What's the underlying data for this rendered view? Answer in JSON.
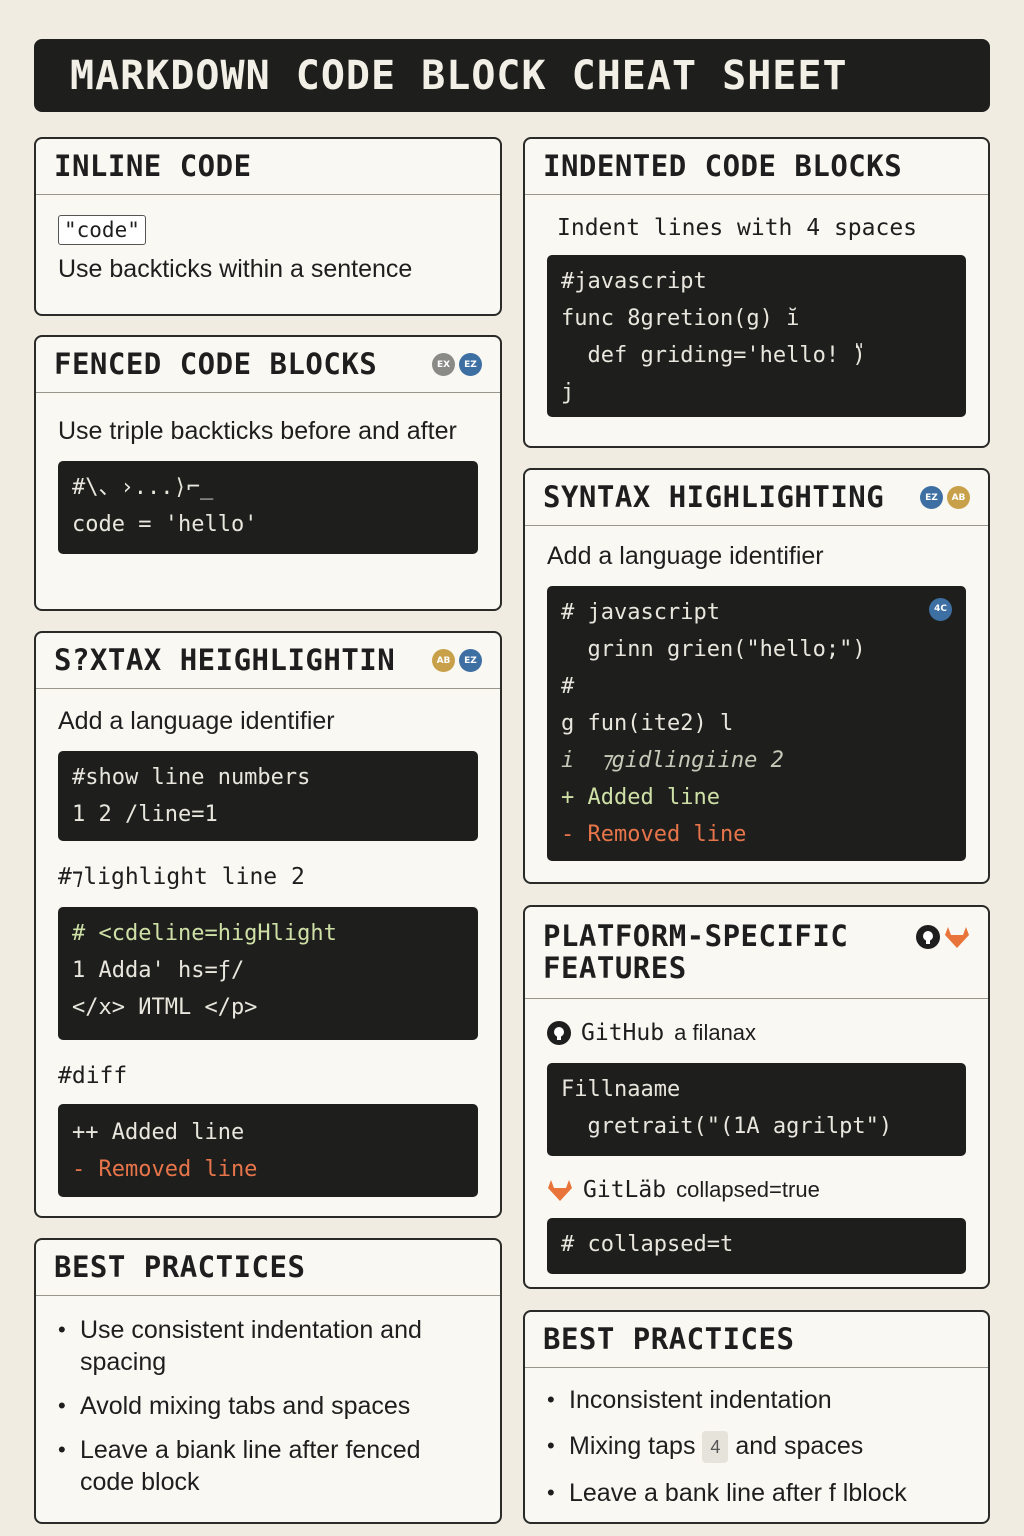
{
  "title": "MARKDOWN CODE BLOCK CHEAT SHEET",
  "inline_code": {
    "heading": "INLINE CODE",
    "chip": "\"code\"",
    "description": "Use backticks within a sentence"
  },
  "fenced": {
    "heading": "FENCED CODE BLOCKS",
    "description": "Use triple backticks before and after",
    "code": [
      "#\\、›...⟩⌐_",
      "code = 'hello'"
    ]
  },
  "syntax_left": {
    "heading": "S?XTAX HEIGHLIGHTIN",
    "description": "Add a language identifier",
    "block1": [
      "#show line numbers",
      "1 2 /line=1"
    ],
    "highlight_label": "#⁊lighlight line 2",
    "block2": [
      "# <cdeline=higHlight",
      "1 Adda' hs=ƒ/",
      "</x> ИTML </p>"
    ],
    "diff_label": "#diff",
    "diff": [
      "++ Added line",
      "- Removed line"
    ]
  },
  "best_left": {
    "heading": "BEST PRACTICES",
    "items": [
      "Use consistent indentation and spacing",
      "Avold mixing tabs and spaces",
      "Leave a biank line after fenced code block"
    ]
  },
  "indented": {
    "heading": "INDENTED CODE BLOCKS",
    "description": "Indent lines with 4 spaces",
    "code": [
      "#javascript",
      "func 8gretion(g) ĭ",
      "  def griding='hello! ̎)",
      "j"
    ]
  },
  "syntax_right": {
    "heading": "SYNTAX HIGHLIGHTING",
    "description": "Add a language identifier",
    "code": [
      "# javascript",
      "  grinn grien(\"hello;\")",
      "#",
      "g fun(ite2) l",
      "i  ⁊gidlingiine 2"
    ],
    "added": "+ Added line",
    "removed": "- Removed line",
    "badge": "4C"
  },
  "platform": {
    "heading": "PLATFORM-SPECIFIC FEATURES",
    "github_label": "GitHub",
    "github_extra": "a filanax",
    "github_code": [
      "Fillnaame",
      "  gretrait(\"(1A agrilpt\")"
    ],
    "gitlab_label": "GitLäb",
    "gitlab_extra": "collapsed=true",
    "gitlab_code": [
      "# collapsed=t"
    ]
  },
  "best_right": {
    "heading": "BEST PRACTICES",
    "item1": "Inconsistent indentation",
    "item2_a": "Mixing taps",
    "item2_chip": "4",
    "item2_b": "and spaces",
    "item3": "Leave a bank line after f lblock"
  },
  "icon_badges": {
    "gray": "EX",
    "blue": "EZ",
    "gold": "AB",
    "blue2": "EZ"
  },
  "colors": {
    "page_bg": "#f0ece2",
    "card_bg": "#faf8f2",
    "code_bg": "#1e1f1d",
    "added": "#cfe0a6",
    "removed": "#e8744a",
    "badge_blue": "#3d6fa3",
    "badge_gold": "#c8a04a"
  }
}
